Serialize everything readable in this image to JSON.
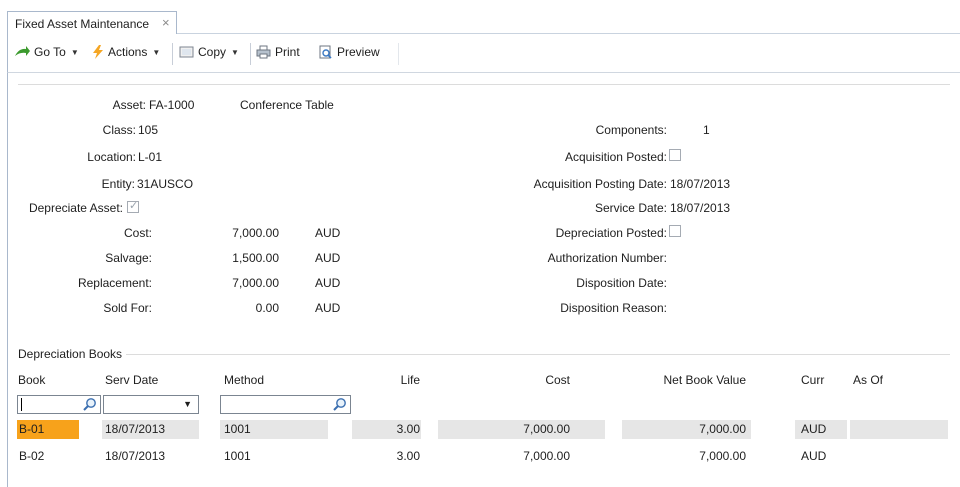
{
  "tab": {
    "title": "Fixed Asset Maintenance",
    "close": "×"
  },
  "toolbar": {
    "goto": "Go To",
    "actions": "Actions",
    "copy": "Copy",
    "print": "Print",
    "preview": "Preview"
  },
  "asset": {
    "asset_label": "Asset:",
    "asset_value": "FA-1000",
    "description": "Conference Table",
    "class_label": "Class:",
    "class_value": "105",
    "location_label": "Location:",
    "location_value": "L-01",
    "entity_label": "Entity:",
    "entity_value": "31AUSCO",
    "depreciate_label": "Depreciate Asset:",
    "depreciate_checked": true,
    "cost_label": "Cost:",
    "cost_value": "7,000.00",
    "cost_curr": "AUD",
    "salvage_label": "Salvage:",
    "salvage_value": "1,500.00",
    "salvage_curr": "AUD",
    "replacement_label": "Replacement:",
    "replacement_value": "7,000.00",
    "replacement_curr": "AUD",
    "sold_label": "Sold For:",
    "sold_value": "0.00",
    "sold_curr": "AUD"
  },
  "right": {
    "components_label": "Components:",
    "components_value": "1",
    "acq_posted_label": "Acquisition Posted:",
    "acq_posted_checked": false,
    "acq_date_label": "Acquisition Posting Date:",
    "acq_date_value": "18/07/2013",
    "service_label": "Service Date:",
    "service_value": "18/07/2013",
    "dep_posted_label": "Depreciation Posted:",
    "dep_posted_checked": false,
    "auth_label": "Authorization Number:",
    "disp_date_label": "Disposition Date:",
    "disp_reason_label": "Disposition Reason:"
  },
  "books": {
    "section_title": "Depreciation Books",
    "columns": [
      "Book",
      "Serv Date",
      "Method",
      "Life",
      "Cost",
      "Net Book Value",
      "Curr",
      "As Of"
    ],
    "rows": [
      {
        "book": "B-01",
        "serv_date": "18/07/2013",
        "method": "1001",
        "life": "3.00",
        "cost": "7,000.00",
        "nbv": "7,000.00",
        "curr": "AUD"
      },
      {
        "book": "B-02",
        "serv_date": "18/07/2013",
        "method": "1001",
        "life": "3.00",
        "cost": "7,000.00",
        "nbv": "7,000.00",
        "curr": "AUD"
      }
    ]
  },
  "colors": {
    "selected_cell": "#f7a21b",
    "row_highlight": "#e6e6e6",
    "tab_border": "#a9b8cc"
  }
}
